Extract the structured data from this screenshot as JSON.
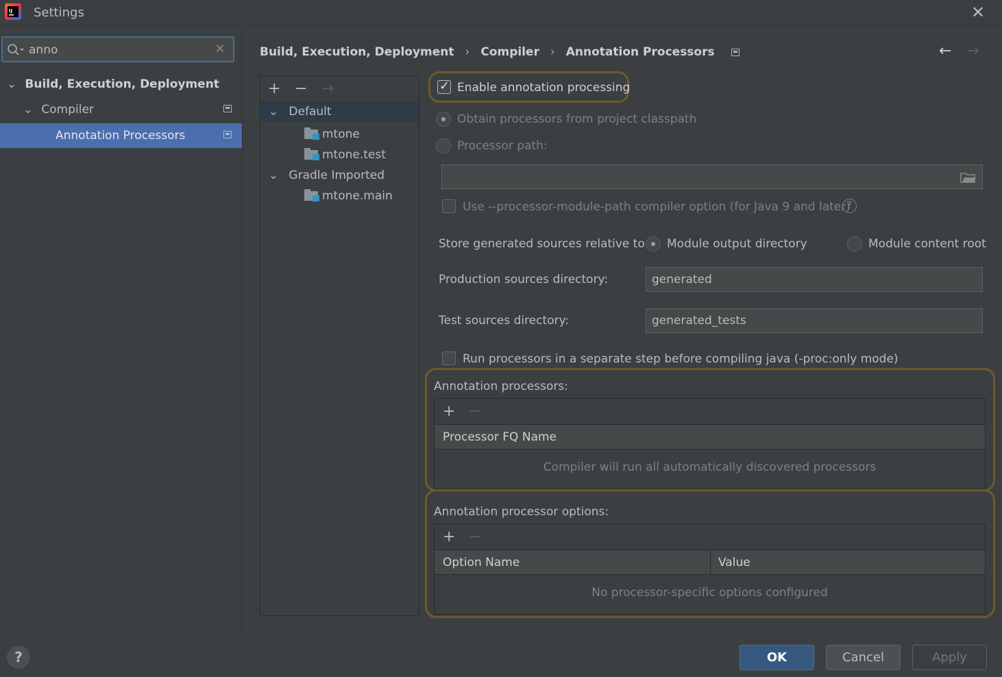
{
  "window": {
    "title": "Settings"
  },
  "search": {
    "value": "anno"
  },
  "sidebar": {
    "items": [
      {
        "label": "Build, Execution, Deployment"
      },
      {
        "label": "Compiler"
      },
      {
        "label": "Annotation Processors"
      }
    ]
  },
  "breadcrumb": [
    "Build, Execution, Deployment",
    "Compiler",
    "Annotation Processors"
  ],
  "profiles": {
    "groups": [
      {
        "label": "Default",
        "modules": [
          "mtone",
          "mtone.test"
        ]
      },
      {
        "label": "Gradle Imported",
        "modules": [
          "mtone.main"
        ]
      }
    ]
  },
  "settings": {
    "enable_annotation_processing": {
      "label": "Enable annotation processing",
      "checked": true
    },
    "obtain_from_classpath": {
      "label": "Obtain processors from project classpath"
    },
    "processor_path": {
      "label": "Processor path:",
      "value": ""
    },
    "module_path_option": {
      "label": "Use --processor-module-path compiler option (for Java 9 and later)"
    },
    "store_relative_label": "Store generated sources relative to:",
    "module_output_dir": "Module output directory",
    "module_content_root": "Module content root",
    "production_dir_label": "Production sources directory:",
    "production_dir_value": "generated",
    "test_dir_label": "Test sources directory:",
    "test_dir_value": "generated_tests",
    "run_separate_step": "Run processors in a separate step before compiling java (-proc:only mode)"
  },
  "annotation_processors": {
    "title": "Annotation processors:",
    "column": "Processor FQ Name",
    "empty_text": "Compiler will run all automatically discovered processors"
  },
  "processor_options": {
    "title": "Annotation processor options:",
    "columns": [
      "Option Name",
      "Value"
    ],
    "empty_text": "No processor-specific options configured"
  },
  "footer": {
    "help": "?",
    "ok": "OK",
    "cancel": "Cancel",
    "apply": "Apply"
  },
  "colors": {
    "background": "#3c3f41",
    "selection": "#4b6eaf",
    "highlight_outline": "#6e5a2a",
    "primary_button": "#365880"
  }
}
